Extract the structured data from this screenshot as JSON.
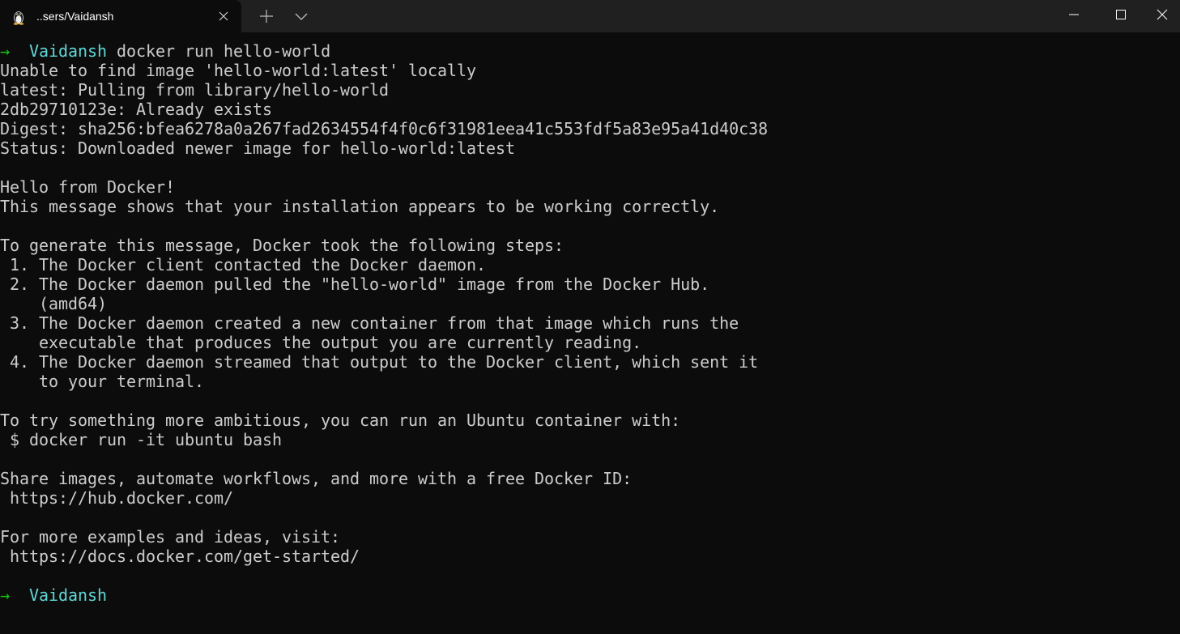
{
  "tab": {
    "title": "..sers/Vaidansh",
    "icon": "linux-penguin-icon"
  },
  "window_controls": {
    "minimize_icon": "minimize-icon",
    "maximize_icon": "maximize-icon",
    "close_icon": "close-icon"
  },
  "colors": {
    "background": "#0c0c0c",
    "titlebar": "#202020",
    "text": "#cccccc",
    "prompt_arrow": "#16c60c",
    "prompt_cwd": "#61d6d6"
  },
  "prompt1": {
    "arrow": "→",
    "cwd": "Vaidansh",
    "command": " docker run hello-world"
  },
  "output": [
    "Unable to find image 'hello-world:latest' locally",
    "latest: Pulling from library/hello-world",
    "2db29710123e: Already exists",
    "Digest: sha256:bfea6278a0a267fad2634554f4f0c6f31981eea41c553fdf5a83e95a41d40c38",
    "Status: Downloaded newer image for hello-world:latest",
    "",
    "Hello from Docker!",
    "This message shows that your installation appears to be working correctly.",
    "",
    "To generate this message, Docker took the following steps:",
    " 1. The Docker client contacted the Docker daemon.",
    " 2. The Docker daemon pulled the \"hello-world\" image from the Docker Hub.",
    "    (amd64)",
    " 3. The Docker daemon created a new container from that image which runs the",
    "    executable that produces the output you are currently reading.",
    " 4. The Docker daemon streamed that output to the Docker client, which sent it",
    "    to your terminal.",
    "",
    "To try something more ambitious, you can run an Ubuntu container with:",
    " $ docker run -it ubuntu bash",
    "",
    "Share images, automate workflows, and more with a free Docker ID:",
    " https://hub.docker.com/",
    "",
    "For more examples and ideas, visit:",
    " https://docs.docker.com/get-started/",
    ""
  ],
  "prompt2": {
    "arrow": "→",
    "cwd": "Vaidansh"
  }
}
